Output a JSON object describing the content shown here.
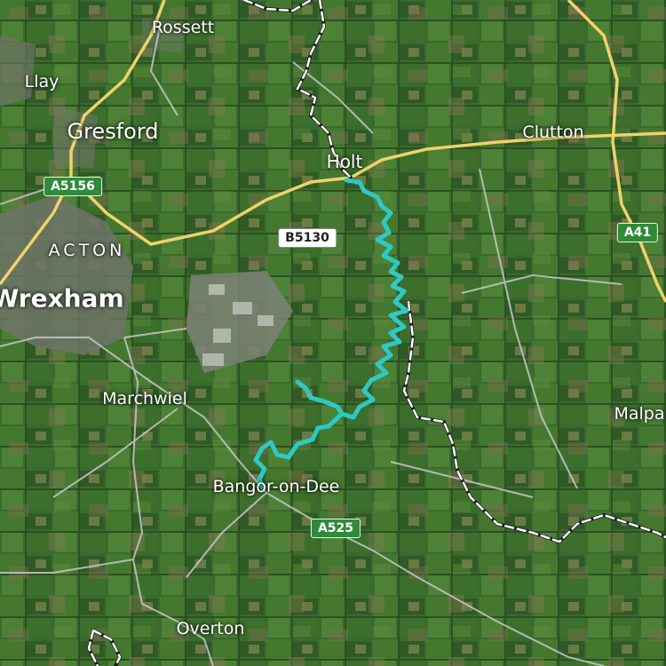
{
  "map": {
    "places": [
      {
        "id": "rossett",
        "label": "Rossett"
      },
      {
        "id": "llay",
        "label": "Llay"
      },
      {
        "id": "gresford",
        "label": "Gresford"
      },
      {
        "id": "acton",
        "label": "ACTON"
      },
      {
        "id": "wrexham",
        "label": "Wrexham"
      },
      {
        "id": "holt",
        "label": "Holt"
      },
      {
        "id": "clutton",
        "label": "Clutton"
      },
      {
        "id": "marchwiel",
        "label": "Marchwiel"
      },
      {
        "id": "malpas",
        "label": "Malpa"
      },
      {
        "id": "bangor",
        "label": "Bangor-on-Dee"
      },
      {
        "id": "overton",
        "label": "Overton"
      }
    ],
    "road_shields": [
      {
        "id": "a5156",
        "label": "A5156",
        "class": "A-road"
      },
      {
        "id": "b5130",
        "label": "B5130",
        "class": "B-road"
      },
      {
        "id": "a41",
        "label": "A41",
        "class": "A-road"
      },
      {
        "id": "a525",
        "label": "A525",
        "class": "A-road"
      }
    ],
    "colors": {
      "route": "#2ec9c3",
      "major_road": "#f2d16b",
      "minor_road": "#c8c8c8",
      "border": "#ffffff",
      "a_road_shield": "#2f8a3b",
      "b_road_shield": "#ffffff"
    }
  }
}
